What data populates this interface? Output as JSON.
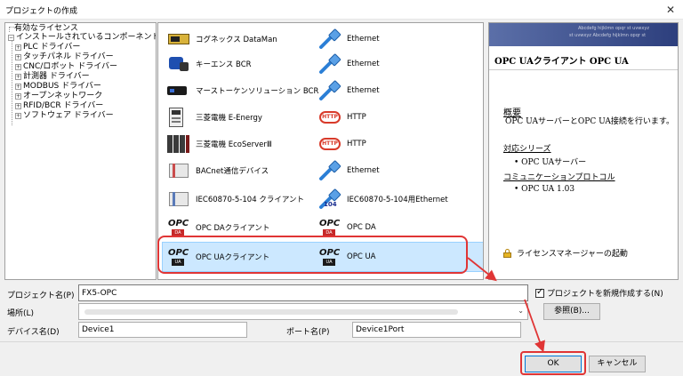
{
  "window": {
    "title": "プロジェクトの作成",
    "close_glyph": "✕"
  },
  "tree": {
    "root": "有効なライセンス",
    "group": "インストールされているコンポーネント",
    "children": [
      "PLC ドライバー",
      "タッチパネル ドライバー",
      "CNC/ロボット ドライバー",
      "計測器 ドライバー",
      "MODBUS ドライバー",
      "オープンネットワーク",
      "RFID/BCR ドライバー",
      "ソフトウェア ドライバー"
    ]
  },
  "list": {
    "rows": [
      {
        "left": "コグネックス DataMan",
        "left_icon": "dataman-device-icon",
        "right": "Ethernet",
        "right_icon": "ethernet-cable-icon"
      },
      {
        "left": "キーエンス BCR",
        "left_icon": "barcode-reader-icon",
        "right": "Ethernet",
        "right_icon": "ethernet-cable-icon"
      },
      {
        "left": "マーストーケンソリューション BCR",
        "left_icon": "scanner-icon",
        "right": "Ethernet",
        "right_icon": "ethernet-cable-icon"
      },
      {
        "left": "三菱電機 E-Energy",
        "left_icon": "energy-meter-icon",
        "right": "HTTP",
        "right_icon": "http-icon"
      },
      {
        "left": "三菱電機 EcoServerⅢ",
        "left_icon": "eco-server-icon",
        "right": "HTTP",
        "right_icon": "http-icon"
      },
      {
        "left": "BACnet通信デバイス",
        "left_icon": "bacnet-device-icon",
        "right": "Ethernet",
        "right_icon": "ethernet-cable-icon"
      },
      {
        "left": "IEC60870-5-104 クライアント",
        "left_icon": "iec-client-icon",
        "right": "IEC60870-5-104用Ethernet",
        "right_icon": "iec-ethernet-icon"
      },
      {
        "left": "OPC DAクライアント",
        "left_icon": "opc-da-icon",
        "right": "OPC DA",
        "right_icon": "opc-da-icon"
      },
      {
        "left": "OPC UAクライアント",
        "left_icon": "opc-ua-icon",
        "right": "OPC UA",
        "right_icon": "opc-ua-icon"
      }
    ],
    "icon_texts": {
      "http": "HTTP",
      "opc": "OPC",
      "da": "DA",
      "ua": "UA",
      "iec_badge": "104"
    }
  },
  "description": {
    "banner_text_1": "Abcdefg hijklmn opqr st uvwxyz",
    "banner_text_2": "st uvwxyz Abcdefg hijklmn opqr st",
    "title": "OPC UAクライアント OPC UA",
    "overview_heading": "概要",
    "overview_text": "OPC UAサーバーとOPC UA接続を行います。",
    "series_heading": "対応シリーズ",
    "series_items": [
      "OPC UAサーバー"
    ],
    "protocol_heading": "コミュニケーションプロトコル",
    "protocol_items": [
      "OPC UA 1.03"
    ],
    "license_link": "ライセンスマネージャーの起動"
  },
  "form": {
    "project_name_label": "プロジェクト名(P)",
    "project_name_value": "FX5-OPC",
    "location_label": "場所(L)",
    "location_value": "",
    "create_new_label": "プロジェクトを新規作成する(N)",
    "create_new_checked": true,
    "browse_label": "参照(B)...",
    "device_name_label": "デバイス名(D)",
    "device_name_value": "Device1",
    "port_name_label": "ポート名(P)",
    "port_name_value": "Device1Port",
    "ok_label": "OK",
    "cancel_label": "キャンセル"
  },
  "colors": {
    "highlight_red": "#e03535",
    "selection": "#cce8ff",
    "link_blue": "#1a0dab"
  }
}
